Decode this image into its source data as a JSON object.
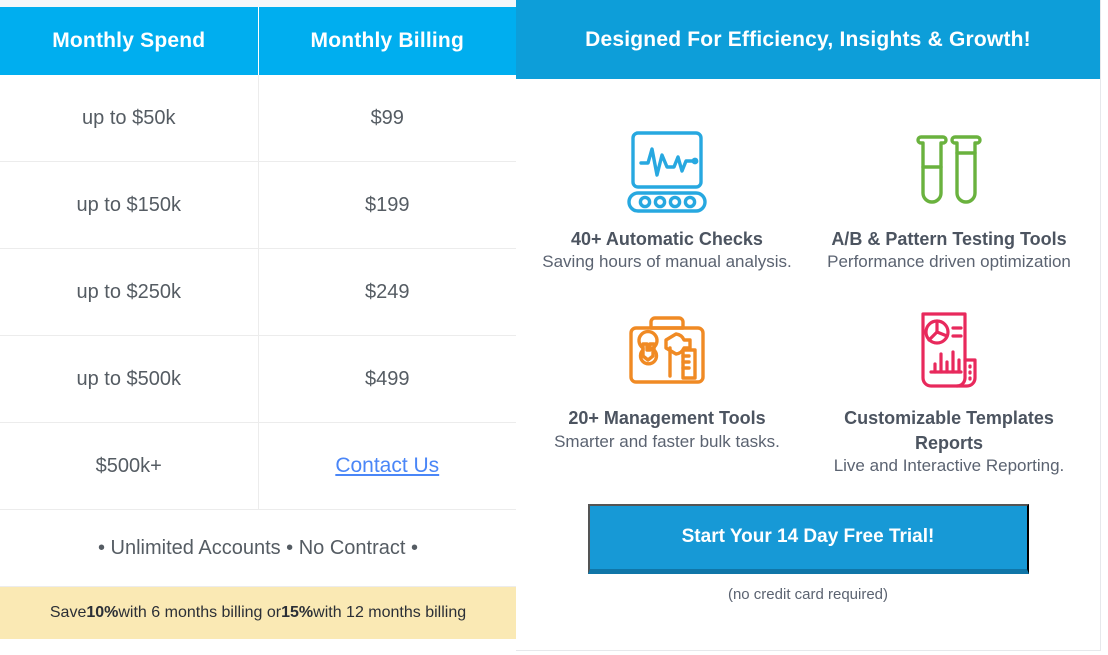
{
  "pricing": {
    "columns": [
      "Monthly Spend",
      "Monthly Billing"
    ],
    "rows": [
      {
        "spend": "up to $50k",
        "billing": "$99"
      },
      {
        "spend": "up to $150k",
        "billing": "$199"
      },
      {
        "spend": "up to $250k",
        "billing": "$249"
      },
      {
        "spend": "up to $500k",
        "billing": "$499"
      },
      {
        "spend": "$500k+",
        "billing": "Contact Us",
        "is_link": true
      }
    ],
    "perks": "• Unlimited Accounts • No Contract •",
    "save_banner": {
      "prefix": "Save ",
      "discount_1": "10%",
      "middle": " with 6 months billing or ",
      "discount_2": "15%",
      "suffix": " with 12 months billing"
    }
  },
  "features": {
    "header": "Designed For Efficiency, Insights & Growth!",
    "items": [
      {
        "icon": "monitor-heartbeat-icon",
        "color": "#27a8e0",
        "title": "40+ Automatic Checks",
        "subtitle": "Saving hours of manual analysis."
      },
      {
        "icon": "test-tubes-icon",
        "color": "#6ab23e",
        "title": "A/B & Pattern Testing Tools",
        "subtitle": "Performance driven optimization"
      },
      {
        "icon": "toolbox-icon",
        "color": "#f08a24",
        "title": "20+ Management Tools",
        "subtitle": "Smarter and faster bulk tasks."
      },
      {
        "icon": "report-document-icon",
        "color": "#e8295c",
        "title": "Customizable Templates Reports",
        "subtitle": "Live and Interactive Reporting."
      }
    ],
    "cta_label": "Start Your 14 Day Free Trial!",
    "cta_note": "(no credit card required)"
  },
  "colors": {
    "table_header_blue": "#00aeef",
    "panel_header_blue": "#0d9ed9",
    "cta_blue": "#1799d6",
    "cta_shadow": "#1076a8",
    "save_banner_yellow": "#fae9b4",
    "link_blue": "#4a86f7"
  }
}
